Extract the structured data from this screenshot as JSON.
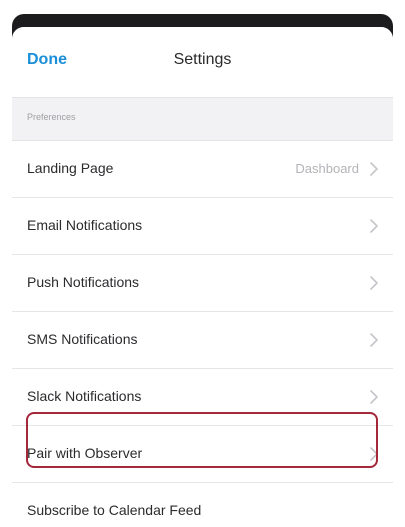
{
  "nav": {
    "done_label": "Done",
    "title": "Settings"
  },
  "section": {
    "header": "Preferences"
  },
  "rows": [
    {
      "label": "Landing Page",
      "value": "Dashboard"
    },
    {
      "label": "Email Notifications",
      "value": ""
    },
    {
      "label": "Push Notifications",
      "value": ""
    },
    {
      "label": "SMS Notifications",
      "value": ""
    },
    {
      "label": "Slack Notifications",
      "value": ""
    },
    {
      "label": "Pair with Observer",
      "value": ""
    },
    {
      "label": "Subscribe to Calendar Feed",
      "value": ""
    }
  ],
  "colors": {
    "accent": "#1a8fd8",
    "highlight": "#a5273a",
    "section_bg": "#f2f2f4"
  },
  "icons": {
    "chevron": "chevron-right-icon"
  }
}
